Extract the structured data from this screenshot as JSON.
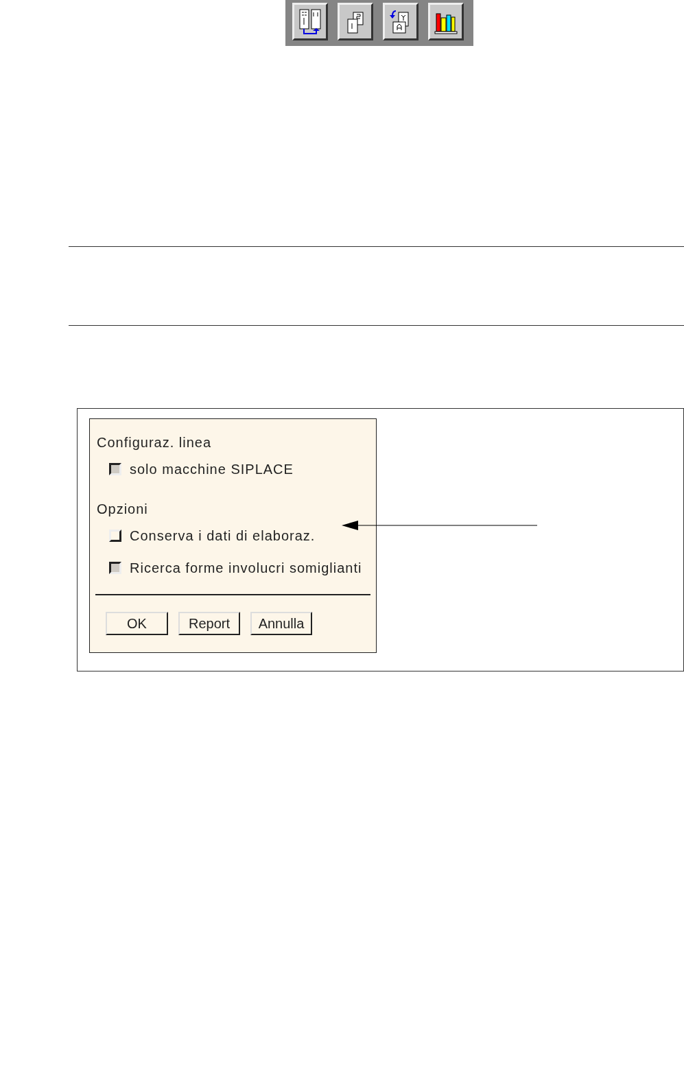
{
  "toolbar": {
    "buttons": [
      {
        "kind": "compare"
      },
      {
        "kind": "pages"
      },
      {
        "kind": "replace"
      },
      {
        "kind": "library"
      }
    ]
  },
  "dialog": {
    "sections": [
      {
        "title": "Configuraz. linea",
        "options": [
          {
            "label": "solo macchine SIPLACE",
            "checked": true
          }
        ]
      },
      {
        "title": "Opzioni",
        "options": [
          {
            "label": "Conserva i dati di elaboraz.",
            "checked": false
          },
          {
            "label": "Ricerca forme involucri somiglianti",
            "checked": true
          }
        ]
      }
    ],
    "buttons": [
      "OK",
      "Report",
      "Annulla"
    ]
  }
}
